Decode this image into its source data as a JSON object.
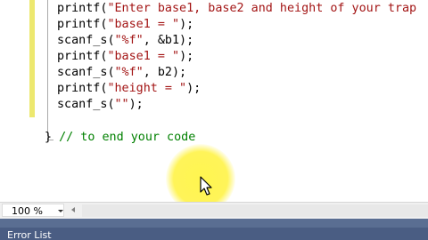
{
  "editor": {
    "lines": [
      {
        "fn": "printf",
        "open": "(",
        "str": "\"Enter base1, base2 and height of your trap",
        "close": ""
      },
      {
        "fn": "printf",
        "open": "(",
        "str": "\"base1 = \"",
        "close": ");"
      },
      {
        "fn": "scanf_s",
        "open": "(",
        "str": "\"%f\"",
        "close": ", &b1);"
      },
      {
        "fn": "printf",
        "open": "(",
        "str": "\"base1 = \"",
        "close": ");"
      },
      {
        "fn": "scanf_s",
        "open": "(",
        "str": "\"%f\"",
        "close": ", b2);"
      },
      {
        "fn": "printf",
        "open": "(",
        "str": "\"height = \"",
        "close": ");"
      },
      {
        "fn": "scanf_s",
        "open": "(",
        "str": "\"\"",
        "close": ");"
      }
    ],
    "closing_brace": "}",
    "comment": " // to end your code"
  },
  "status": {
    "zoom": "100 %"
  },
  "panels": {
    "error_list_label": "Error List"
  },
  "colors": {
    "string": "#a31515",
    "comment": "#008000",
    "change_margin": "#ede86f",
    "panel": "#4a5d83"
  }
}
